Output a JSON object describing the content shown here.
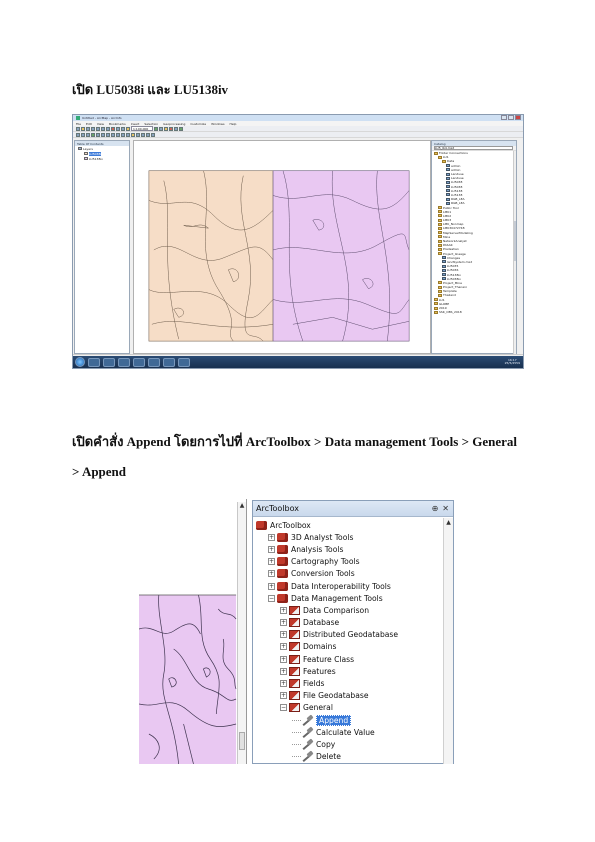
{
  "headings": {
    "open_layers": "เปิด LU5038i และ LU5138iv",
    "open_append_line1": "เปิดคำสั่ง Append โดยการไปที่ ArcToolbox > Data management Tools > General",
    "open_append_line2": "> Append"
  },
  "arcmap": {
    "window_title": "Untitled - ArcMap - ArcInfo",
    "menu": [
      "File",
      "Edit",
      "View",
      "Bookmarks",
      "Insert",
      "Selection",
      "Geoprocessing",
      "Customize",
      "Windows",
      "Help"
    ],
    "scale": "1:100,000",
    "toc_title": "Table Of Contents",
    "toc_items": [
      {
        "label": "Layers",
        "swatch": ""
      },
      {
        "label": "LU5038i",
        "swatch": "#f7ddc6",
        "selected": true
      },
      {
        "label": "LU5138iv",
        "swatch": "#e6c8f0"
      }
    ],
    "catalog_title": "Catalog",
    "catalog_location": "LU5_lb4.mxd",
    "catalog_items": [
      {
        "indent": 0,
        "label": "Folder Connections",
        "type": "folder"
      },
      {
        "indent": 1,
        "label": "LU1",
        "type": "folder"
      },
      {
        "indent": 2,
        "label": "Data",
        "type": "folder"
      },
      {
        "indent": 3,
        "label": "admin",
        "type": "layer"
      },
      {
        "indent": 3,
        "label": "admin",
        "type": "layer"
      },
      {
        "indent": 3,
        "label": "Landuse",
        "type": "layer"
      },
      {
        "indent": 3,
        "label": "Landuse",
        "type": "layer"
      },
      {
        "indent": 3,
        "label": "LU5038",
        "type": "layer"
      },
      {
        "indent": 3,
        "label": "LU5038",
        "type": "layer"
      },
      {
        "indent": 3,
        "label": "LU5138",
        "type": "layer"
      },
      {
        "indent": 3,
        "label": "LU5138",
        "type": "layer"
      },
      {
        "indent": 3,
        "label": "RGB_LEA",
        "type": "layer"
      },
      {
        "indent": 3,
        "label": "RGB_LEA",
        "type": "layer"
      },
      {
        "indent": 1,
        "label": "Public Tool",
        "type": "folder"
      },
      {
        "indent": 1,
        "label": "LMK1",
        "type": "folder"
      },
      {
        "indent": 1,
        "label": "LMK2",
        "type": "folder"
      },
      {
        "indent": 1,
        "label": "LMK3",
        "type": "folder"
      },
      {
        "indent": 1,
        "label": "LMK_Nonmap",
        "type": "folder"
      },
      {
        "indent": 1,
        "label": "LMK30472748",
        "type": "folder"
      },
      {
        "indent": 1,
        "label": "MapServerModeling",
        "type": "folder"
      },
      {
        "indent": 1,
        "label": "Mine",
        "type": "folder"
      },
      {
        "indent": 1,
        "label": "NetworkAnalyst",
        "type": "folder"
      },
      {
        "indent": 1,
        "label": "PASAK",
        "type": "folder"
      },
      {
        "indent": 1,
        "label": "Pradeshan",
        "type": "folder"
      },
      {
        "indent": 1,
        "label": "Project_lineage",
        "type": "folder"
      },
      {
        "indent": 2,
        "label": "Changes",
        "type": "layer"
      },
      {
        "indent": 2,
        "label": "landSystem.mxd",
        "type": "layer"
      },
      {
        "indent": 2,
        "label": "LU5035",
        "type": "layer"
      },
      {
        "indent": 2,
        "label": "LU5036",
        "type": "layer"
      },
      {
        "indent": 2,
        "label": "LU5138iv",
        "type": "layer"
      },
      {
        "indent": 2,
        "label": "LU5038iv",
        "type": "layer"
      },
      {
        "indent": 1,
        "label": "Project_Mine",
        "type": "folder"
      },
      {
        "indent": 1,
        "label": "Project_Thanani",
        "type": "folder"
      },
      {
        "indent": 1,
        "label": "Template",
        "type": "folder"
      },
      {
        "indent": 1,
        "label": "Thailand",
        "type": "folder"
      },
      {
        "indent": 0,
        "label": "LU1",
        "type": "folder"
      },
      {
        "indent": 0,
        "label": "GLOBE",
        "type": "folder"
      },
      {
        "indent": 0,
        "label": "2019",
        "type": "folder"
      },
      {
        "indent": 0,
        "label": "SSK_OBS_2018",
        "type": "folder"
      }
    ],
    "status_text": "644926.798  1600219.315 Meters",
    "clock_time": "16:17",
    "clock_date": "25/5/2559"
  },
  "toolbox": {
    "title": "ArcToolbox",
    "items": [
      {
        "level": 0,
        "label": "ArcToolbox",
        "icon": "toolbox-root",
        "expander": ""
      },
      {
        "level": 1,
        "label": "3D Analyst Tools",
        "icon": "toolbox",
        "expander": "+"
      },
      {
        "level": 1,
        "label": "Analysis Tools",
        "icon": "toolbox",
        "expander": "+"
      },
      {
        "level": 1,
        "label": "Cartography Tools",
        "icon": "toolbox",
        "expander": "+"
      },
      {
        "level": 1,
        "label": "Conversion Tools",
        "icon": "toolbox",
        "expander": "+"
      },
      {
        "level": 1,
        "label": "Data Interoperability Tools",
        "icon": "toolbox",
        "expander": "+"
      },
      {
        "level": 1,
        "label": "Data Management Tools",
        "icon": "toolbox",
        "expander": "−"
      },
      {
        "level": 2,
        "label": "Data Comparison",
        "icon": "toolset",
        "expander": "+"
      },
      {
        "level": 2,
        "label": "Database",
        "icon": "toolset",
        "expander": "+"
      },
      {
        "level": 2,
        "label": "Distributed Geodatabase",
        "icon": "toolset",
        "expander": "+"
      },
      {
        "level": 2,
        "label": "Domains",
        "icon": "toolset",
        "expander": "+"
      },
      {
        "level": 2,
        "label": "Feature Class",
        "icon": "toolset",
        "expander": "+"
      },
      {
        "level": 2,
        "label": "Features",
        "icon": "toolset",
        "expander": "+"
      },
      {
        "level": 2,
        "label": "Fields",
        "icon": "toolset",
        "expander": "+"
      },
      {
        "level": 2,
        "label": "File Geodatabase",
        "icon": "toolset",
        "expander": "+"
      },
      {
        "level": 2,
        "label": "General",
        "icon": "toolset",
        "expander": "−"
      },
      {
        "level": 3,
        "label": "Append",
        "icon": "tool",
        "expander": "",
        "selected": true
      },
      {
        "level": 3,
        "label": "Calculate Value",
        "icon": "tool",
        "expander": ""
      },
      {
        "level": 3,
        "label": "Copy",
        "icon": "tool",
        "expander": ""
      },
      {
        "level": 3,
        "label": "Delete",
        "icon": "tool",
        "expander": ""
      }
    ],
    "pin_icon": "⊕",
    "close_icon": "✕"
  },
  "colors": {
    "lu5038_fill": "#f6ddc7",
    "lu5138_fill": "#e9c8f2",
    "selection": "#3879d9",
    "toolbox_red": "#c0392b"
  }
}
